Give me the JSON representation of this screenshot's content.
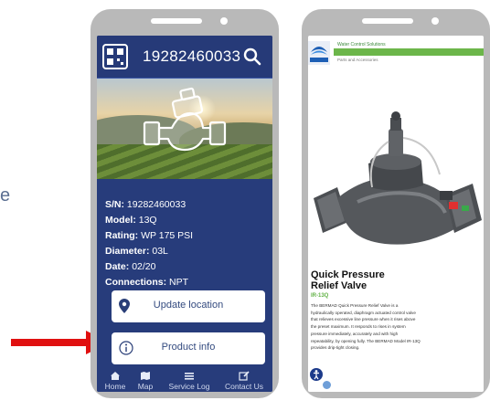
{
  "edge_text": "e",
  "left_phone": {
    "header": {
      "title": "19282460033"
    },
    "specs": [
      {
        "label": "S/N:",
        "value": "19282460033"
      },
      {
        "label": "Model:",
        "value": "13Q"
      },
      {
        "label": "Rating:",
        "value": "WP 175 PSI"
      },
      {
        "label": "Diameter:",
        "value": "03L"
      },
      {
        "label": "Date:",
        "value": "02/20"
      },
      {
        "label": "Connections:",
        "value": "NPT"
      }
    ],
    "buttons": {
      "update_location": "Update location",
      "product_info": "Product info"
    },
    "tabs": [
      {
        "label": "Home",
        "icon": "home-icon"
      },
      {
        "label": "Map",
        "icon": "map-icon"
      },
      {
        "label": "Service Log",
        "icon": "list-icon"
      },
      {
        "label": "Contact Us",
        "icon": "edit-icon"
      }
    ]
  },
  "right_phone": {
    "brand_text": "Water Control Solutions",
    "sub_text": "Parts and Accessories",
    "title_line1": "Quick Pressure",
    "title_line2": "Relief Valve",
    "sku": "IR-13Q",
    "description": "The BERMAD Quick Pressure Relief Valve is a hydraulically operated, diaphragm actuated control valve that relieves excessive line pressure when it rises above the preset maximum. It responds to rises in system pressure immediately, accurately and with high repeatability, by opening fully. The BERMAD Model IR-13Q provides drip-tight closing."
  },
  "colors": {
    "app_navy": "#273c7b",
    "accent_green": "#6cb64a",
    "arrow_red": "#e01010"
  }
}
